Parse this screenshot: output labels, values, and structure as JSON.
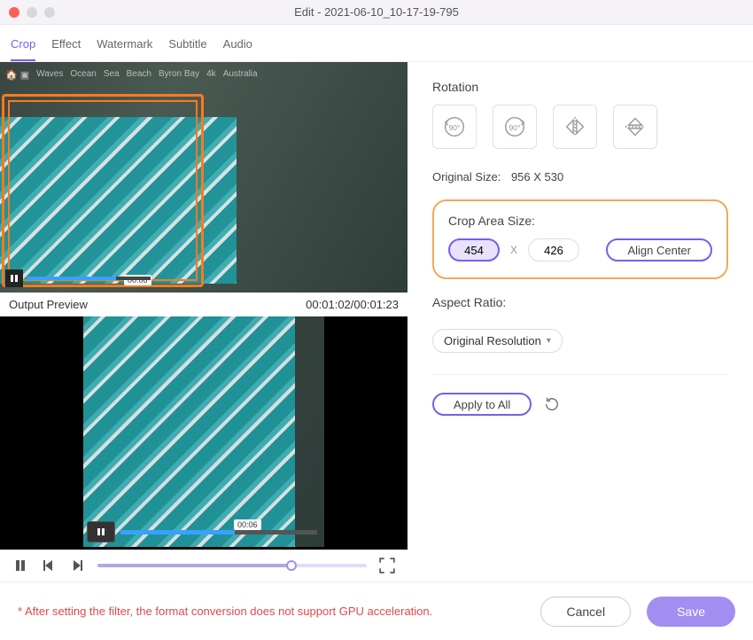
{
  "window": {
    "title": "Edit - 2021-06-10_10-17-19-795"
  },
  "tabs": {
    "crop": "Crop",
    "effect": "Effect",
    "watermark": "Watermark",
    "subtitle": "Subtitle",
    "audio": "Audio",
    "active": "crop"
  },
  "source_tags": [
    "🏠 ▣",
    "Waves",
    "Ocean",
    "Sea",
    "Beach",
    "Byron Bay",
    "4k",
    "Australia"
  ],
  "mini_time": "00:06",
  "output_preview_label": "Output Preview",
  "timecode": "00:01:02/00:01:23",
  "preview_time": "00:06",
  "playback_progress": 72,
  "right": {
    "rotation_label": "Rotation",
    "rot_ccw": "90°",
    "rot_cw": "90°",
    "original_size_label": "Original Size:",
    "original_size_value": "956 X 530",
    "crop_area_label": "Crop Area Size:",
    "crop_w": "454",
    "crop_h": "426",
    "crop_sep": "X",
    "align_center": "Align Center",
    "aspect_label": "Aspect Ratio:",
    "aspect_value": "Original Resolution",
    "apply_all": "Apply to All"
  },
  "footer": {
    "warning": "* After setting the filter, the format conversion does not support GPU acceleration.",
    "cancel": "Cancel",
    "save": "Save"
  }
}
